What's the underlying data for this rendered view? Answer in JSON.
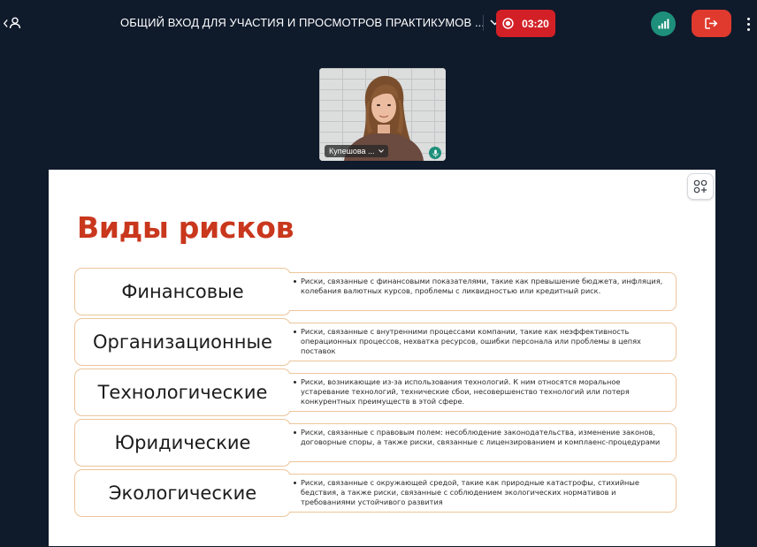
{
  "meeting": {
    "title": "ОБЩИЙ ВХОД ДЛЯ УЧАСТИЯ И ПРОСМОТРОВ ПРАКТИКУМОВ ...",
    "recording_time": "03:20"
  },
  "colors": {
    "background": "#0f1a2b",
    "record": "#d32027",
    "leave": "#e03a2f",
    "signal": "#1d8f7a",
    "slide_title": "#c9371d",
    "box_border": "#ecc59b"
  },
  "icons": {
    "participants": "person-icon",
    "title_chevron": "chevron-down-icon",
    "record": "record-icon",
    "signal": "signal-bars-icon",
    "leave": "exit-icon",
    "more": "more-vertical-icon",
    "layout": "layout-grid-icon",
    "mic": "microphone-icon"
  },
  "video": {
    "participant_name": "Купешова ..."
  },
  "slide": {
    "title": "Виды рисков",
    "risks": [
      {
        "label": "Финансовые",
        "description": "Риски, связанные с финансовыми показателями, такие как превышение бюджета, инфляция, колебания валютных курсов, проблемы с ликвидностью или кредитный риск."
      },
      {
        "label": "Организационные",
        "description": "Риски, связанные с внутренними процессами компании, такие как неэффективность операционных процессов, нехватка ресурсов, ошибки персонала или проблемы в цепях поставок"
      },
      {
        "label": "Технологические",
        "description": "Риски, возникающие из-за использования технологий. К ним относятся моральное устаревание технологий, технические сбои, несовершенство технологий или потеря конкурентных преимуществ в этой сфере."
      },
      {
        "label": "Юридические",
        "description": "Риски, связанные с правовым полем: несоблюдение законодательства, изменение законов, договорные споры, а также риски, связанные с лицензированием и комплаенс-процедурами"
      },
      {
        "label": "Экологические",
        "description": "Риски, связанные с окружающей средой, такие как природные катастрофы, стихийные бедствия, а также риски, связанные с соблюдением экологических нормативов и требованиями устойчивого развития"
      }
    ]
  }
}
